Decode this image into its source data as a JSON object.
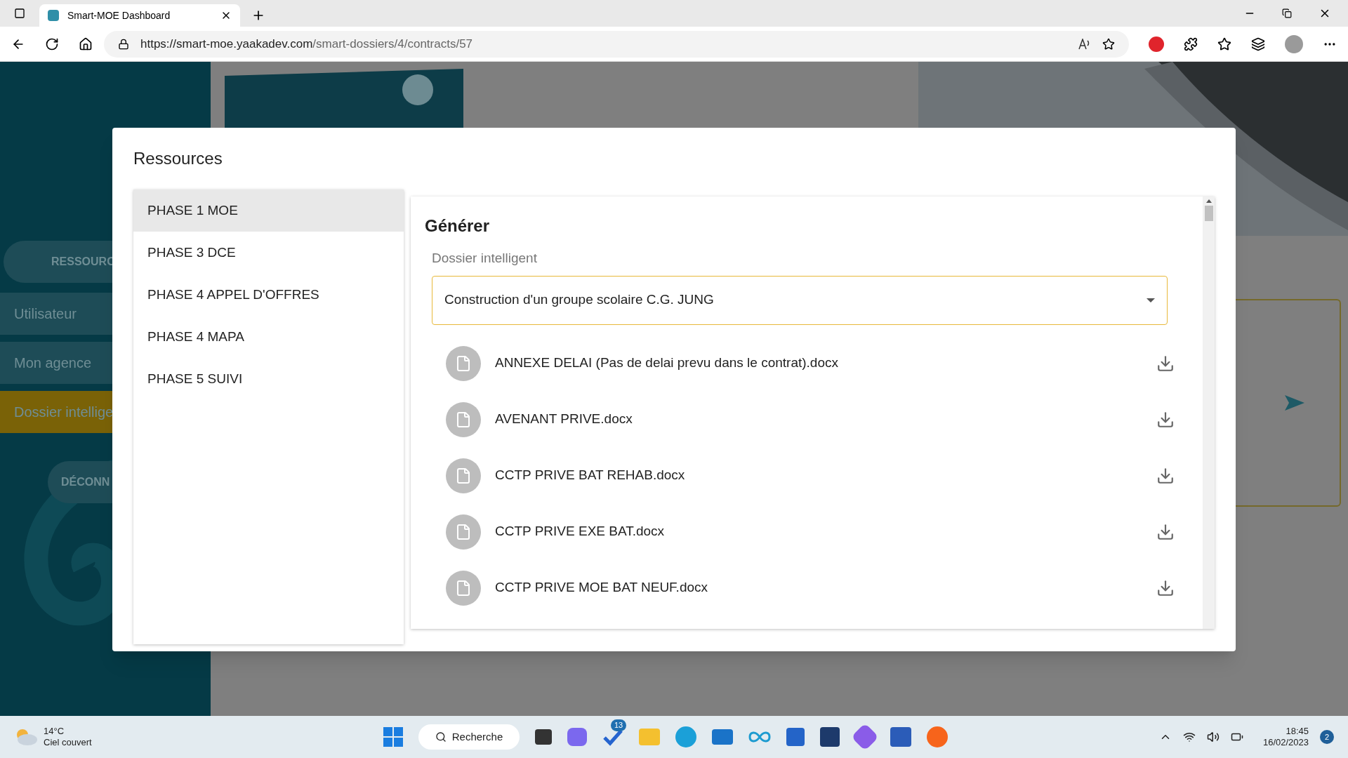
{
  "browser": {
    "tab_title": "Smart-MOE Dashboard",
    "url_host": "https://smart-moe.yaakadev.com",
    "url_path": "/smart-dossiers/4/contracts/57"
  },
  "sidebar": {
    "items": [
      {
        "label": "RESSOURC",
        "kind": "pill"
      },
      {
        "label": "Utilisateur",
        "kind": "item",
        "selected": false
      },
      {
        "label": "Mon agence",
        "kind": "item",
        "selected": false
      },
      {
        "label": "Dossier intellige",
        "kind": "item",
        "selected": true
      },
      {
        "label": "DÉCONN",
        "kind": "logout"
      }
    ]
  },
  "dialog": {
    "title": "Ressources",
    "phases": [
      {
        "label": "PHASE 1 MOE",
        "selected": true
      },
      {
        "label": "PHASE 3 DCE",
        "selected": false
      },
      {
        "label": "PHASE 4 APPEL D'OFFRES",
        "selected": false
      },
      {
        "label": "PHASE 4 MAPA",
        "selected": false
      },
      {
        "label": "PHASE 5 SUIVI",
        "selected": false
      }
    ],
    "section_title": "Générer",
    "field_label": "Dossier intelligent",
    "field_value": "Construction d'un groupe scolaire C.G. JUNG",
    "files": [
      "ANNEXE DELAI (Pas de delai prevu dans le contrat).docx",
      "AVENANT PRIVE.docx",
      "CCTP PRIVE BAT REHAB.docx",
      "CCTP PRIVE EXE BAT.docx",
      "CCTP PRIVE MOE BAT NEUF.docx"
    ]
  },
  "taskbar": {
    "temperature": "14°C",
    "weather": "Ciel couvert",
    "search": "Recherche",
    "todo_badge": "13",
    "time": "18:45",
    "date": "16/02/2023",
    "notifications": "2"
  }
}
